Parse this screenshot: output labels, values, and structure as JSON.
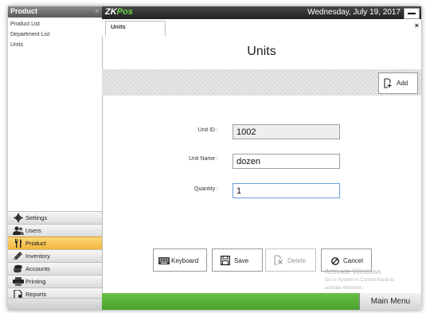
{
  "sidebar": {
    "header": "Product",
    "collapse_glyph": "«",
    "sub_items": [
      "Product List",
      "Department List",
      "Units"
    ],
    "modules": [
      {
        "label": "Settings",
        "icon": "gear-icon"
      },
      {
        "label": "Users",
        "icon": "users-icon"
      },
      {
        "label": "Product",
        "icon": "fork-knife-icon",
        "active": true
      },
      {
        "label": "Inventory",
        "icon": "pencil-icon"
      },
      {
        "label": "Accounts",
        "icon": "coins-icon"
      },
      {
        "label": "Printing",
        "icon": "printer-icon"
      },
      {
        "label": "Reports",
        "icon": "report-icon"
      }
    ]
  },
  "topbar": {
    "logo_zk": "ZK",
    "logo_pos": "Pos",
    "date": "Wednesday, July 19, 2017"
  },
  "tab": {
    "label": "Units",
    "close_glyph": "×"
  },
  "page": {
    "title": "Units",
    "add_label": "Add"
  },
  "form": {
    "unit_id": {
      "label": "Unit ID :",
      "value": "1002"
    },
    "unit_name": {
      "label": "Unit Name :",
      "value": "dozen"
    },
    "quantity": {
      "label": "Quantity :",
      "value": "1"
    }
  },
  "actions": {
    "keyboard": "Keyboard",
    "save": "Save",
    "delete": "Delete",
    "cancel": "Cancel"
  },
  "watermark": {
    "line1": "Activate Windows",
    "line2": "Go to System in Control Panel to",
    "line3": "activate Windows."
  },
  "bottom": {
    "main_menu": "Main Menu"
  },
  "colors": {
    "accent_green": "#5cb43c",
    "active_module": "#f3b53a"
  }
}
